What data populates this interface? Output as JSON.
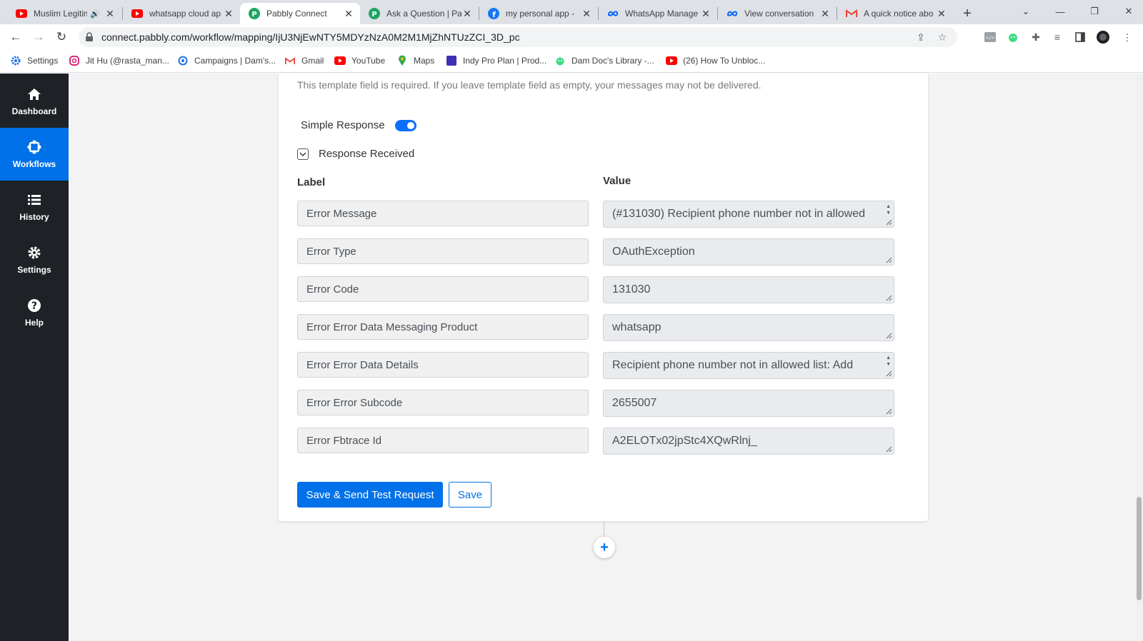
{
  "browser": {
    "tabs": [
      {
        "title": "Muslim Legitim",
        "icon": "youtube-icon",
        "audio": true,
        "active": false
      },
      {
        "title": "whatsapp cloud ap",
        "icon": "youtube-icon",
        "audio": false,
        "active": false
      },
      {
        "title": "Pabbly Connect",
        "icon": "pabbly-icon",
        "audio": false,
        "active": true
      },
      {
        "title": "Ask a Question | Pa",
        "icon": "pabbly-icon",
        "audio": false,
        "active": false
      },
      {
        "title": "my personal app -",
        "icon": "facebook-icon",
        "audio": false,
        "active": false
      },
      {
        "title": "WhatsApp Manage",
        "icon": "meta-icon",
        "audio": false,
        "active": false
      },
      {
        "title": "View conversation",
        "icon": "meta-icon",
        "audio": false,
        "active": false
      },
      {
        "title": "A quick notice abo",
        "icon": "gmail-icon",
        "audio": false,
        "active": false
      }
    ],
    "url": "connect.pabbly.com/workflow/mapping/IjU3NjEwNTY5MDYzNzA0M2M1MjZhNTUzZCI_3D_pc",
    "bookmarks": [
      {
        "label": "Settings",
        "icon": "gear-icon"
      },
      {
        "label": "Jit Hu (@rasta_man...",
        "icon": "instagram-icon"
      },
      {
        "label": "Campaigns | Dam's...",
        "icon": "campaign-icon"
      },
      {
        "label": "Gmail",
        "icon": "gmail-icon"
      },
      {
        "label": "YouTube",
        "icon": "youtube-icon"
      },
      {
        "label": "Maps",
        "icon": "maps-icon"
      },
      {
        "label": "Indy Pro Plan | Prod...",
        "icon": "indy-icon"
      },
      {
        "label": "Dam Doc's Library -...",
        "icon": "android-icon"
      },
      {
        "label": "(26) How To Unbloc...",
        "icon": "youtube-icon"
      }
    ]
  },
  "sidebar": {
    "items": [
      {
        "label": "Dashboard",
        "icon": "home-icon",
        "active": false
      },
      {
        "label": "Workflows",
        "icon": "workflow-icon",
        "active": true
      },
      {
        "label": "History",
        "icon": "list-icon",
        "active": false
      },
      {
        "label": "Settings",
        "icon": "gear-icon",
        "active": false
      },
      {
        "label": "Help",
        "icon": "question-icon",
        "active": false
      }
    ]
  },
  "main": {
    "hint": "This template field is required. If you leave template field as empty, your messages may not be delivered.",
    "simple_response_label": "Simple Response",
    "simple_response_on": true,
    "response_received_label": "Response Received",
    "label_header": "Label",
    "value_header": "Value",
    "rows": [
      {
        "label": "Error Message",
        "value": "(#131030) Recipient phone number not in allowed"
      },
      {
        "label": "Error Type",
        "value": "OAuthException"
      },
      {
        "label": "Error Code",
        "value": "131030"
      },
      {
        "label": "Error Error Data Messaging Product",
        "value": "whatsapp"
      },
      {
        "label": "Error Error Data Details",
        "value": "Recipient phone number not in allowed list: Add"
      },
      {
        "label": "Error Error Subcode",
        "value": "2655007"
      },
      {
        "label": "Error Fbtrace Id",
        "value": "A2ELOTx02jpStc4XQwRlnj_"
      }
    ],
    "save_send_label": "Save & Send Test Request",
    "save_label": "Save",
    "add_step_label": "+"
  },
  "colors": {
    "sidebar_bg": "#1e2226",
    "accent": "#0071e8",
    "page_bg": "#f3f3f3"
  }
}
